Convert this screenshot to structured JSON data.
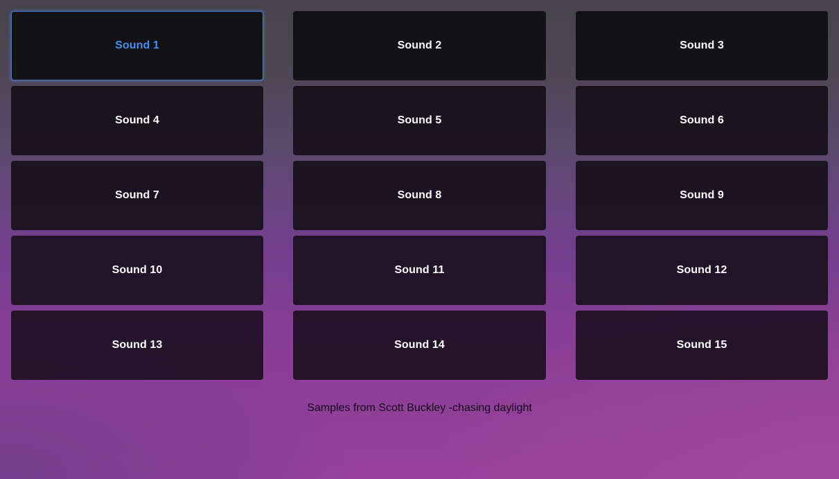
{
  "pads": [
    {
      "label": "Sound 1"
    },
    {
      "label": "Sound 2"
    },
    {
      "label": "Sound 3"
    },
    {
      "label": "Sound 4"
    },
    {
      "label": "Sound 5"
    },
    {
      "label": "Sound 6"
    },
    {
      "label": "Sound 7"
    },
    {
      "label": "Sound 8"
    },
    {
      "label": "Sound 9"
    },
    {
      "label": "Sound 10"
    },
    {
      "label": "Sound 11"
    },
    {
      "label": "Sound 12"
    },
    {
      "label": "Sound 13"
    },
    {
      "label": "Sound 14"
    },
    {
      "label": "Sound 15"
    }
  ],
  "focused_pad": "Sound 1",
  "footer": {
    "credit": "Samples from Scott Buckley -chasing daylight"
  },
  "colors": {
    "pad_background": "#0e0c12",
    "pad_text": "#ffffff",
    "focus_text": "#4a8cf0",
    "focus_border": "#4a79c8",
    "footer_text": "#14091a"
  }
}
